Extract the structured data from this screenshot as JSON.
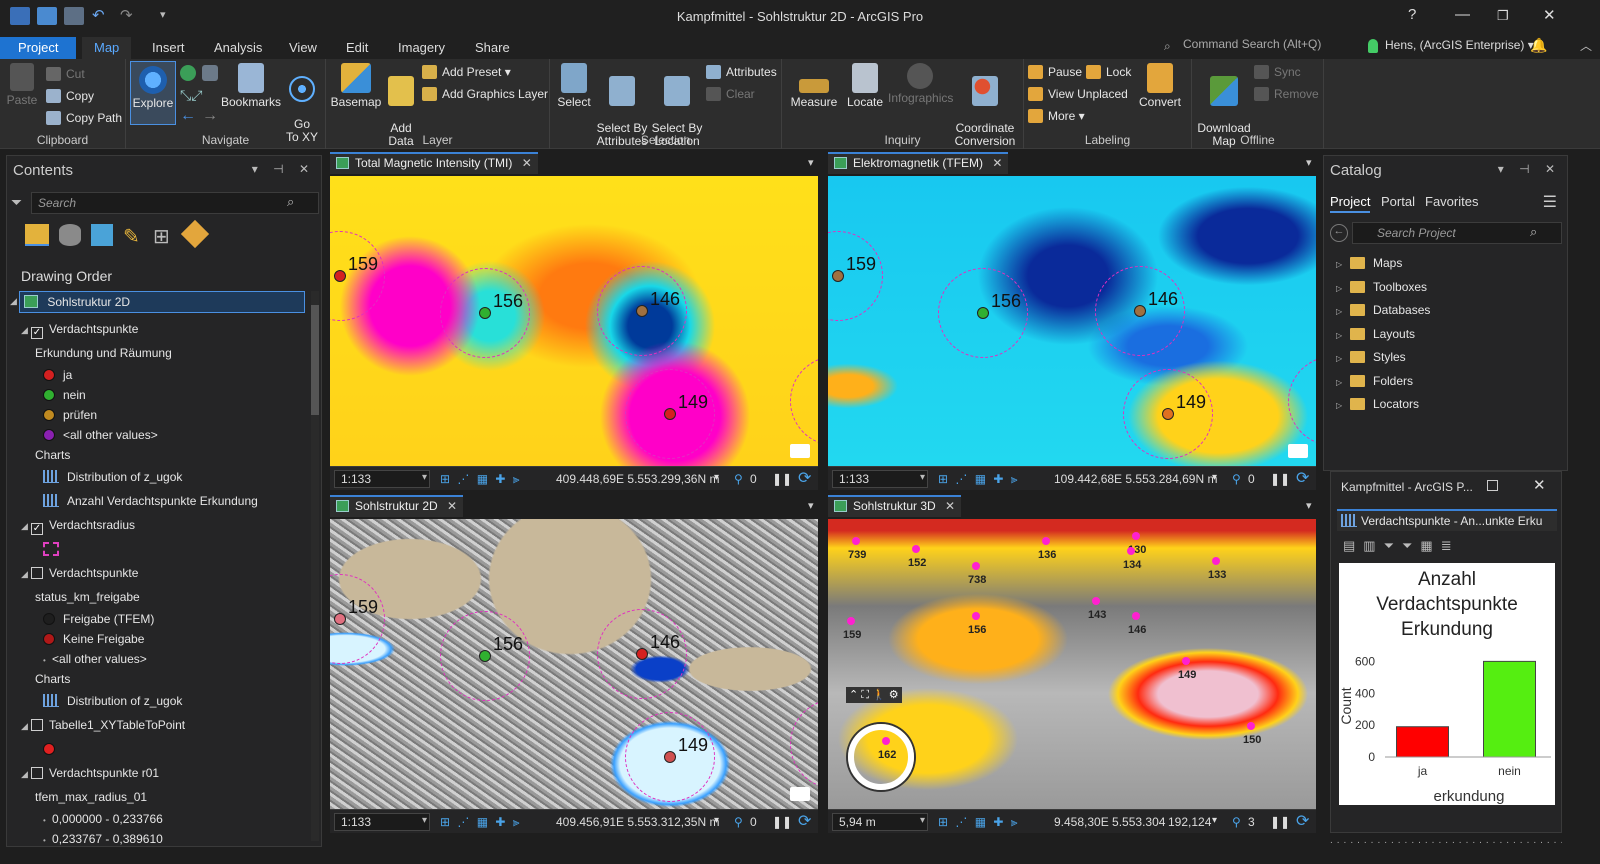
{
  "window": {
    "title": "Kampfmittel - Sohlstruktur 2D - ArcGIS Pro",
    "help": "?",
    "minimize": "—",
    "maximize": "❐",
    "close": "✕"
  },
  "ribbon_tabs": [
    "Project",
    "Map",
    "Insert",
    "Analysis",
    "View",
    "Edit",
    "Imagery",
    "Share"
  ],
  "command_search": {
    "placeholder": "Command Search (Alt+Q)"
  },
  "user": {
    "label": "Hens, (ArcGIS Enterprise) ▾"
  },
  "ribbon": {
    "clipboard": {
      "label": "Clipboard",
      "paste": "Paste",
      "cut": "Cut",
      "copy": "Copy",
      "copy_path": "Copy Path"
    },
    "navigate": {
      "label": "Navigate",
      "explore": "Explore",
      "bookmarks": "Bookmarks",
      "go_to_xy": "Go\nTo XY"
    },
    "layer": {
      "label": "Layer",
      "basemap": "Basemap",
      "add_data": "Add\nData",
      "add_preset": "Add Preset",
      "add_graphics_layer": "Add Graphics Layer"
    },
    "selection": {
      "label": "Selection",
      "select": "Select",
      "select_by_attributes": "Select By\nAttributes",
      "select_by_location": "Select By\nLocation",
      "attributes": "Attributes",
      "clear": "Clear"
    },
    "inquiry": {
      "label": "Inquiry",
      "measure": "Measure",
      "locate": "Locate",
      "infographics": "Infographics",
      "coordinate_conversion": "Coordinate\nConversion"
    },
    "labeling": {
      "label": "Labeling",
      "pause": "Pause",
      "lock": "Lock",
      "view_unplaced": "View Unplaced",
      "more": "More",
      "convert": "Convert"
    },
    "offline": {
      "label": "Offline",
      "download_map": "Download\nMap",
      "sync": "Sync",
      "remove": "Remove"
    }
  },
  "contents": {
    "title": "Contents",
    "search_placeholder": "Search",
    "drawing_order": "Drawing Order",
    "map_name": "Sohlstruktur 2D",
    "items": [
      {
        "text": "Verdachtspunkte",
        "kind": "layer",
        "checked": true
      },
      {
        "text": "Erkundung und Räumung",
        "kind": "heading"
      },
      {
        "text": "ja",
        "kind": "symbol",
        "color": "#d42020"
      },
      {
        "text": "nein",
        "kind": "symbol",
        "color": "#30b030"
      },
      {
        "text": "prüfen",
        "kind": "symbol",
        "color": "#c08a20"
      },
      {
        "text": "<all other values>",
        "kind": "symbol",
        "color": "#8a20b0"
      },
      {
        "text": "Charts",
        "kind": "heading"
      },
      {
        "text": "Distribution of z_ugok",
        "kind": "chart"
      },
      {
        "text": "Anzahl Verdachtspunkte Erkundung",
        "kind": "chart"
      },
      {
        "text": "Verdachtsradius",
        "kind": "layer",
        "checked": true
      },
      {
        "text": "",
        "kind": "dashed"
      },
      {
        "text": "Verdachtspunkte",
        "kind": "layer",
        "checked": false
      },
      {
        "text": "status_km_freigabe",
        "kind": "heading"
      },
      {
        "text": "Freigabe (TFEM)",
        "kind": "symbol",
        "color": "#1e1e1e"
      },
      {
        "text": "Keine Freigabe",
        "kind": "symbol",
        "color": "#b01818"
      },
      {
        "text": "<all other values>",
        "kind": "small"
      },
      {
        "text": "Charts",
        "kind": "heading"
      },
      {
        "text": "Distribution of z_ugok",
        "kind": "chart"
      },
      {
        "text": "Tabelle1_XYTableToPoint",
        "kind": "layer",
        "checked": false
      },
      {
        "text": "",
        "kind": "reddot"
      },
      {
        "text": "Verdachtspunkte r01",
        "kind": "layer",
        "checked": false
      },
      {
        "text": "tfem_max_radius_01",
        "kind": "heading"
      },
      {
        "text": "0,000000 - 0,233766",
        "kind": "small"
      },
      {
        "text": "0,233767 - 0,389610",
        "kind": "small"
      }
    ]
  },
  "maps": [
    {
      "tab": "Total Magnetic Intensity (TMI)",
      "scale": "1:133",
      "coords": "409.448,69E 5.553.299,36N m",
      "sel": "0",
      "points": [
        {
          "label": "159",
          "color": "#d42020"
        },
        {
          "label": "156",
          "color": "#30b030"
        },
        {
          "label": "146",
          "color": "#a07040"
        },
        {
          "label": "149",
          "color": "#d42020"
        }
      ]
    },
    {
      "tab": "Elektromagnetik (TFEM)",
      "scale": "1:133",
      "coords": "109.442,68E 5.553.284,69N m",
      "sel": "0",
      "points": [
        {
          "label": "159",
          "color": "#a07040"
        },
        {
          "label": "156",
          "color": "#30b030"
        },
        {
          "label": "146",
          "color": "#a07040"
        },
        {
          "label": "149",
          "color": "#e07020"
        }
      ]
    },
    {
      "tab": "Sohlstruktur 2D",
      "scale": "1:133",
      "coords": "409.456,91E 5.553.312,35N m",
      "sel": "0",
      "points": [
        {
          "label": "159",
          "color": "#e07080"
        },
        {
          "label": "156",
          "color": "#30b030"
        },
        {
          "label": "146",
          "color": "#d42020"
        },
        {
          "label": "149",
          "color": "#d05050"
        }
      ]
    },
    {
      "tab": "Sohlstruktur 3D",
      "scale": "5,94 m",
      "coords": "9.458,30E 5.553.304,78N m",
      "extra": "192,124",
      "sel": "3",
      "labels": [
        "739",
        "152",
        "738",
        "136",
        "130",
        "134",
        "133",
        "143",
        "156",
        "146",
        "159",
        "149",
        "150",
        "162"
      ]
    }
  ],
  "catalog": {
    "title": "Catalog",
    "tabs": [
      "Project",
      "Portal",
      "Favorites"
    ],
    "search_placeholder": "Search Project",
    "items": [
      "Maps",
      "Toolboxes",
      "Databases",
      "Layouts",
      "Styles",
      "Folders",
      "Locators"
    ]
  },
  "chart_window": {
    "title": "Kampfmittel - ArcGIS P...",
    "tab": "Verdachtspunkte - An...unkte Erku"
  },
  "chart_data": {
    "type": "bar",
    "title": "Anzahl Verdachtspunkte Erkundung",
    "categories": [
      "ja",
      "nein"
    ],
    "values": [
      190,
      600
    ],
    "colors": [
      "#ff0000",
      "#55ee11"
    ],
    "xlabel": "erkundung",
    "ylabel": "Count",
    "ylim": [
      0,
      640
    ],
    "yticks": [
      0,
      200,
      400,
      600
    ]
  }
}
